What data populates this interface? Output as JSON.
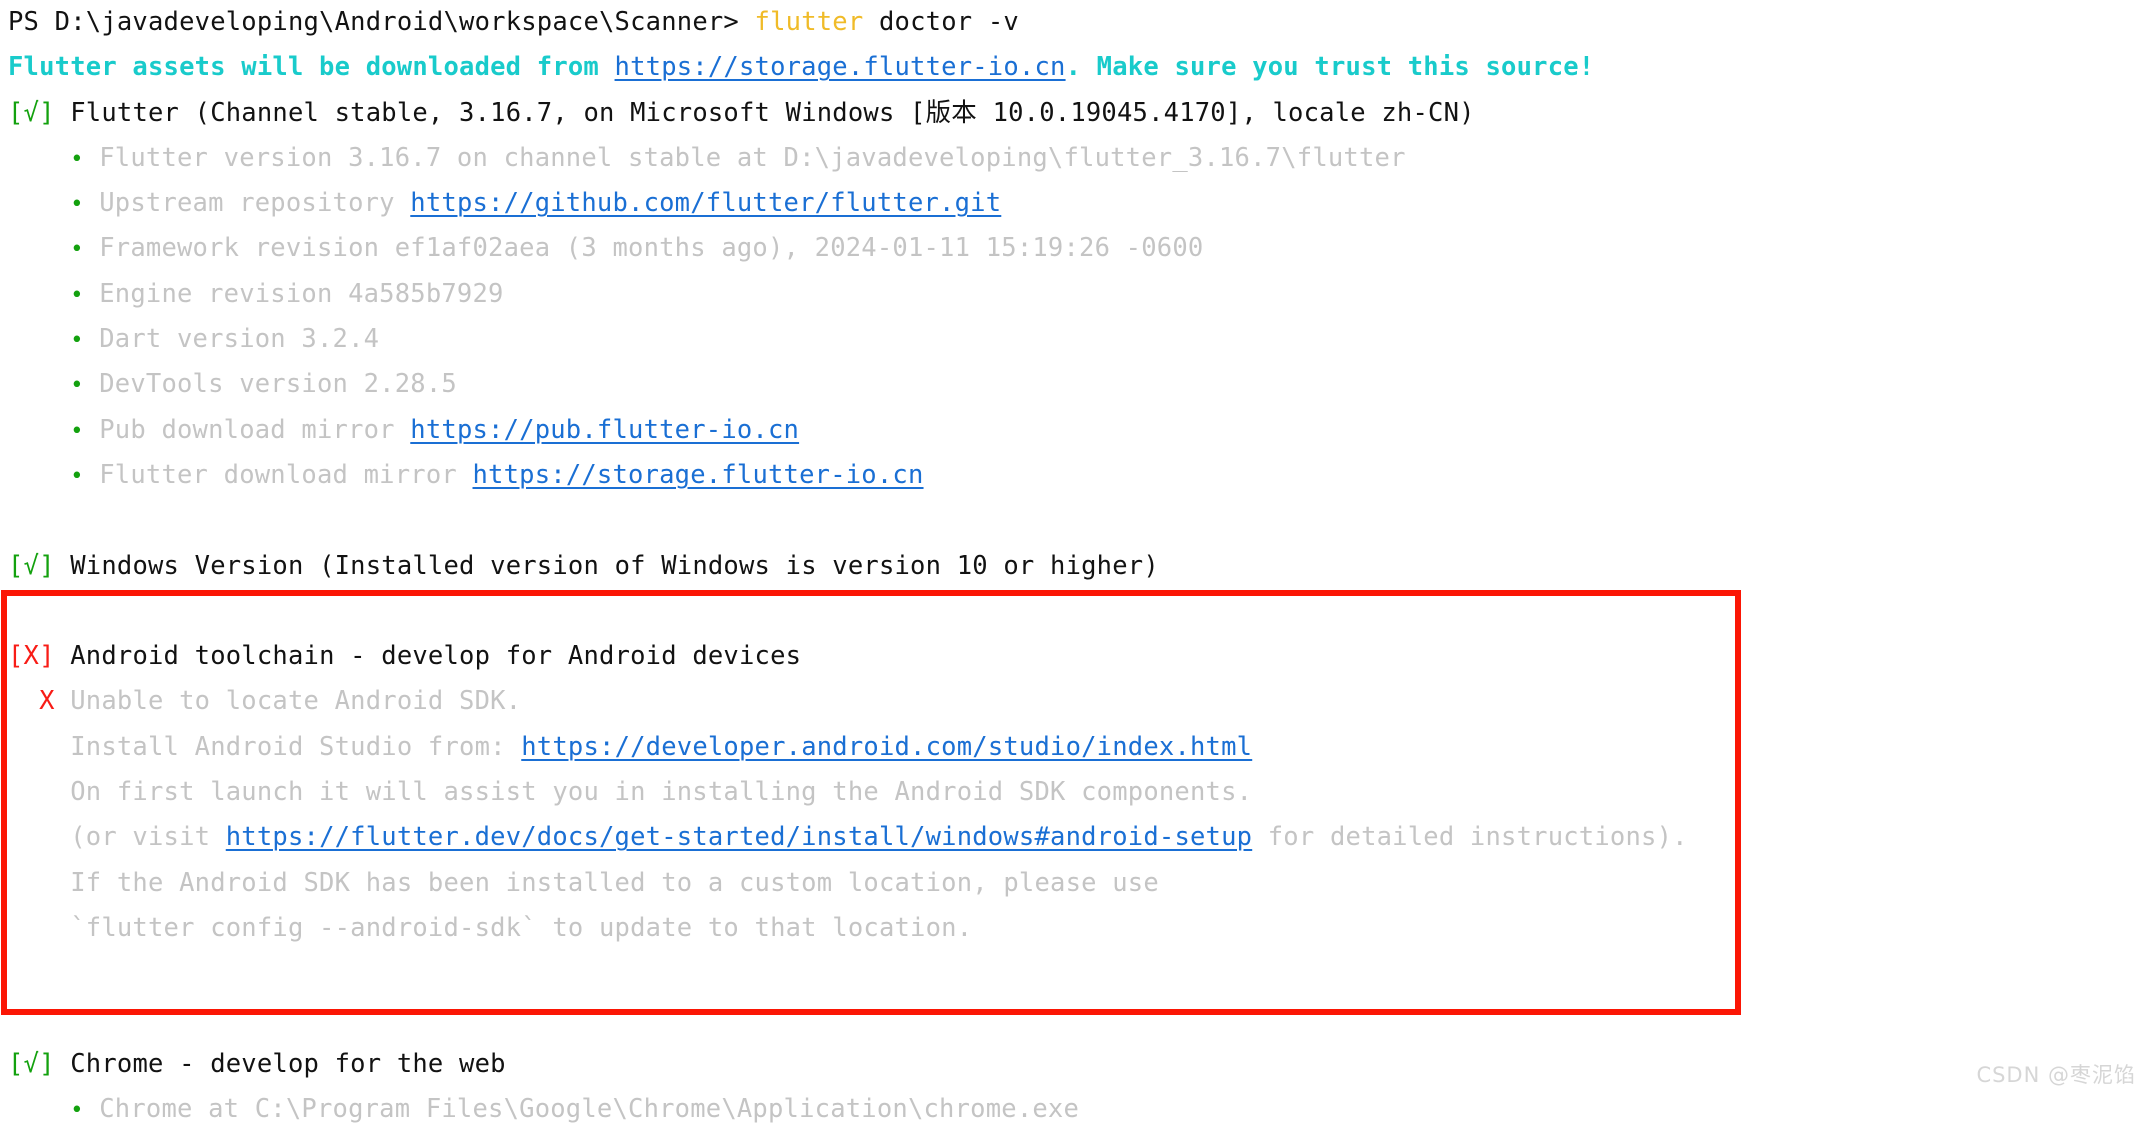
{
  "colors": {
    "background": "#ffffff",
    "default_text": "#121212",
    "command": "#f0bb28",
    "cyan": "#19cbcb",
    "link": "#1a6fd4",
    "dim_grey": "#c4c4c4",
    "green": "#13a10e",
    "red": "#f81c16",
    "annotation_box": "#fb1605",
    "watermark": "#d6d6d6"
  },
  "prompt": {
    "shell": "PS",
    "path": "D:\\javadeveloping\\Android\\workspace\\Scanner>",
    "command": "flutter",
    "args": "doctor -v"
  },
  "notice": {
    "prefix": "Flutter assets will be downloaded from ",
    "url": "https://storage.flutter-io.cn",
    "suffix": ". Make sure you trust this source!"
  },
  "sections": [
    {
      "status": "[√]",
      "status_kind": "ok",
      "title": "Flutter (Channel stable, 3.16.7, on Microsoft Windows [版本 10.0.19045.4170], locale zh-CN)",
      "items": [
        {
          "text": "Flutter version 3.16.7 on channel stable at D:\\javadeveloping\\flutter_3.16.7\\flutter",
          "url": "",
          "url_after": ""
        },
        {
          "text": "Upstream repository ",
          "url": "https://github.com/flutter/flutter.git",
          "url_after": ""
        },
        {
          "text": "Framework revision ef1af02aea (3 months ago), 2024-01-11 15:19:26 -0600",
          "url": "",
          "url_after": ""
        },
        {
          "text": "Engine revision 4a585b7929",
          "url": "",
          "url_after": ""
        },
        {
          "text": "Dart version 3.2.4",
          "url": "",
          "url_after": ""
        },
        {
          "text": "DevTools version 2.28.5",
          "url": "",
          "url_after": ""
        },
        {
          "text": "Pub download mirror ",
          "url": "https://pub.flutter-io.cn",
          "url_after": ""
        },
        {
          "text": "Flutter download mirror ",
          "url": "https://storage.flutter-io.cn",
          "url_after": ""
        }
      ]
    },
    {
      "status": "[√]",
      "status_kind": "ok",
      "title": "Windows Version (Installed version of Windows is version 10 or higher)",
      "items": []
    },
    {
      "status": "[X]",
      "status_kind": "error",
      "title": "Android toolchain - develop for Android devices",
      "error_marker": "X",
      "error_text": "Unable to locate Android SDK.",
      "detail_lines": [
        {
          "text": "Install Android Studio from: ",
          "url": "https://developer.android.com/studio/index.html",
          "url_after": ""
        },
        {
          "text": "On first launch it will assist you in installing the Android SDK components.",
          "url": "",
          "url_after": ""
        },
        {
          "text": "(or visit ",
          "url": "https://flutter.dev/docs/get-started/install/windows#android-setup",
          "url_after": " for detailed instructions)."
        },
        {
          "text": "If the Android SDK has been installed to a custom location, please use",
          "url": "",
          "url_after": ""
        },
        {
          "text": "`flutter config --android-sdk` to update to that location.",
          "url": "",
          "url_after": ""
        }
      ]
    },
    {
      "status": "[√]",
      "status_kind": "ok",
      "title": "Chrome - develop for the web",
      "items": [
        {
          "text": "Chrome at C:\\Program Files\\Google\\Chrome\\Application\\chrome.exe",
          "url": "",
          "url_after": ""
        }
      ]
    }
  ],
  "watermark": "CSDN @枣泥馅"
}
